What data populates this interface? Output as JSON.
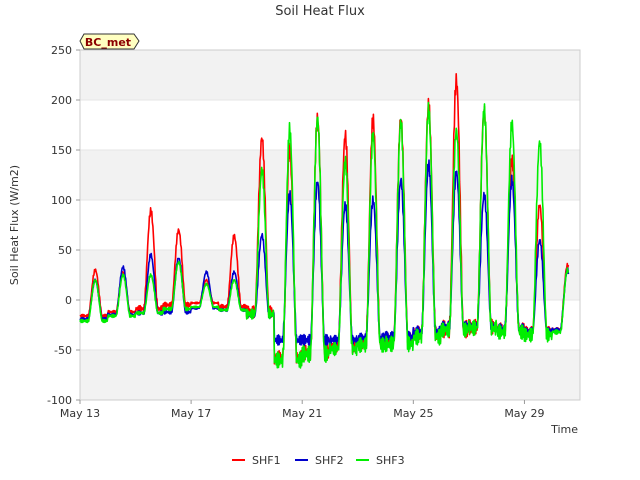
{
  "chart_data": {
    "type": "line",
    "title": "Soil Heat Flux",
    "xlabel": "Time",
    "ylabel": "Soil Heat Flux (W/m2)",
    "badge": "BC_met",
    "xlim": [
      "2024-05-13",
      "2024-05-31"
    ],
    "ylim": [
      -100,
      250
    ],
    "y_ticks": [
      -100,
      -50,
      0,
      50,
      100,
      150,
      200,
      250
    ],
    "x_ticks": [
      {
        "date": "2024-05-13",
        "label": "May 13"
      },
      {
        "date": "2024-05-17",
        "label": "May 17"
      },
      {
        "date": "2024-05-21",
        "label": "May 21"
      },
      {
        "date": "2024-05-25",
        "label": "May 25"
      },
      {
        "date": "2024-05-29",
        "label": "May 29"
      }
    ],
    "grid": "horizontal alternating bands",
    "legend_position": "bottom",
    "series": [
      {
        "name": "SHF1",
        "color": "#ff0000",
        "daily_min": [
          -16,
          -12,
          -9,
          -5,
          -3,
          -7,
          -12,
          -58,
          -52,
          -46,
          -42,
          -40,
          -34,
          -29,
          -27,
          -29,
          -31,
          -30
        ],
        "daily_max": [
          30,
          28,
          89,
          70,
          20,
          64,
          162,
          150,
          182,
          165,
          180,
          182,
          195,
          220,
          190,
          140,
          95,
          35
        ]
      },
      {
        "name": "SHF2",
        "color": "#0000cc",
        "daily_min": [
          -19,
          -15,
          -13,
          -12,
          -8,
          -10,
          -15,
          -40,
          -40,
          -40,
          -38,
          -37,
          -32,
          -27,
          -26,
          -29,
          -31,
          -30
        ],
        "daily_max": [
          20,
          33,
          45,
          42,
          28,
          28,
          65,
          105,
          118,
          95,
          100,
          120,
          135,
          128,
          105,
          120,
          60,
          30
        ]
      },
      {
        "name": "SHF3",
        "color": "#00ee00",
        "daily_min": [
          -21,
          -16,
          -13,
          -9,
          -7,
          -10,
          -14,
          -60,
          -54,
          -49,
          -45,
          -44,
          -37,
          -30,
          -28,
          -32,
          -35,
          -32
        ],
        "daily_max": [
          20,
          25,
          25,
          38,
          16,
          20,
          130,
          170,
          182,
          138,
          165,
          178,
          190,
          170,
          190,
          176,
          158,
          30
        ]
      }
    ]
  }
}
